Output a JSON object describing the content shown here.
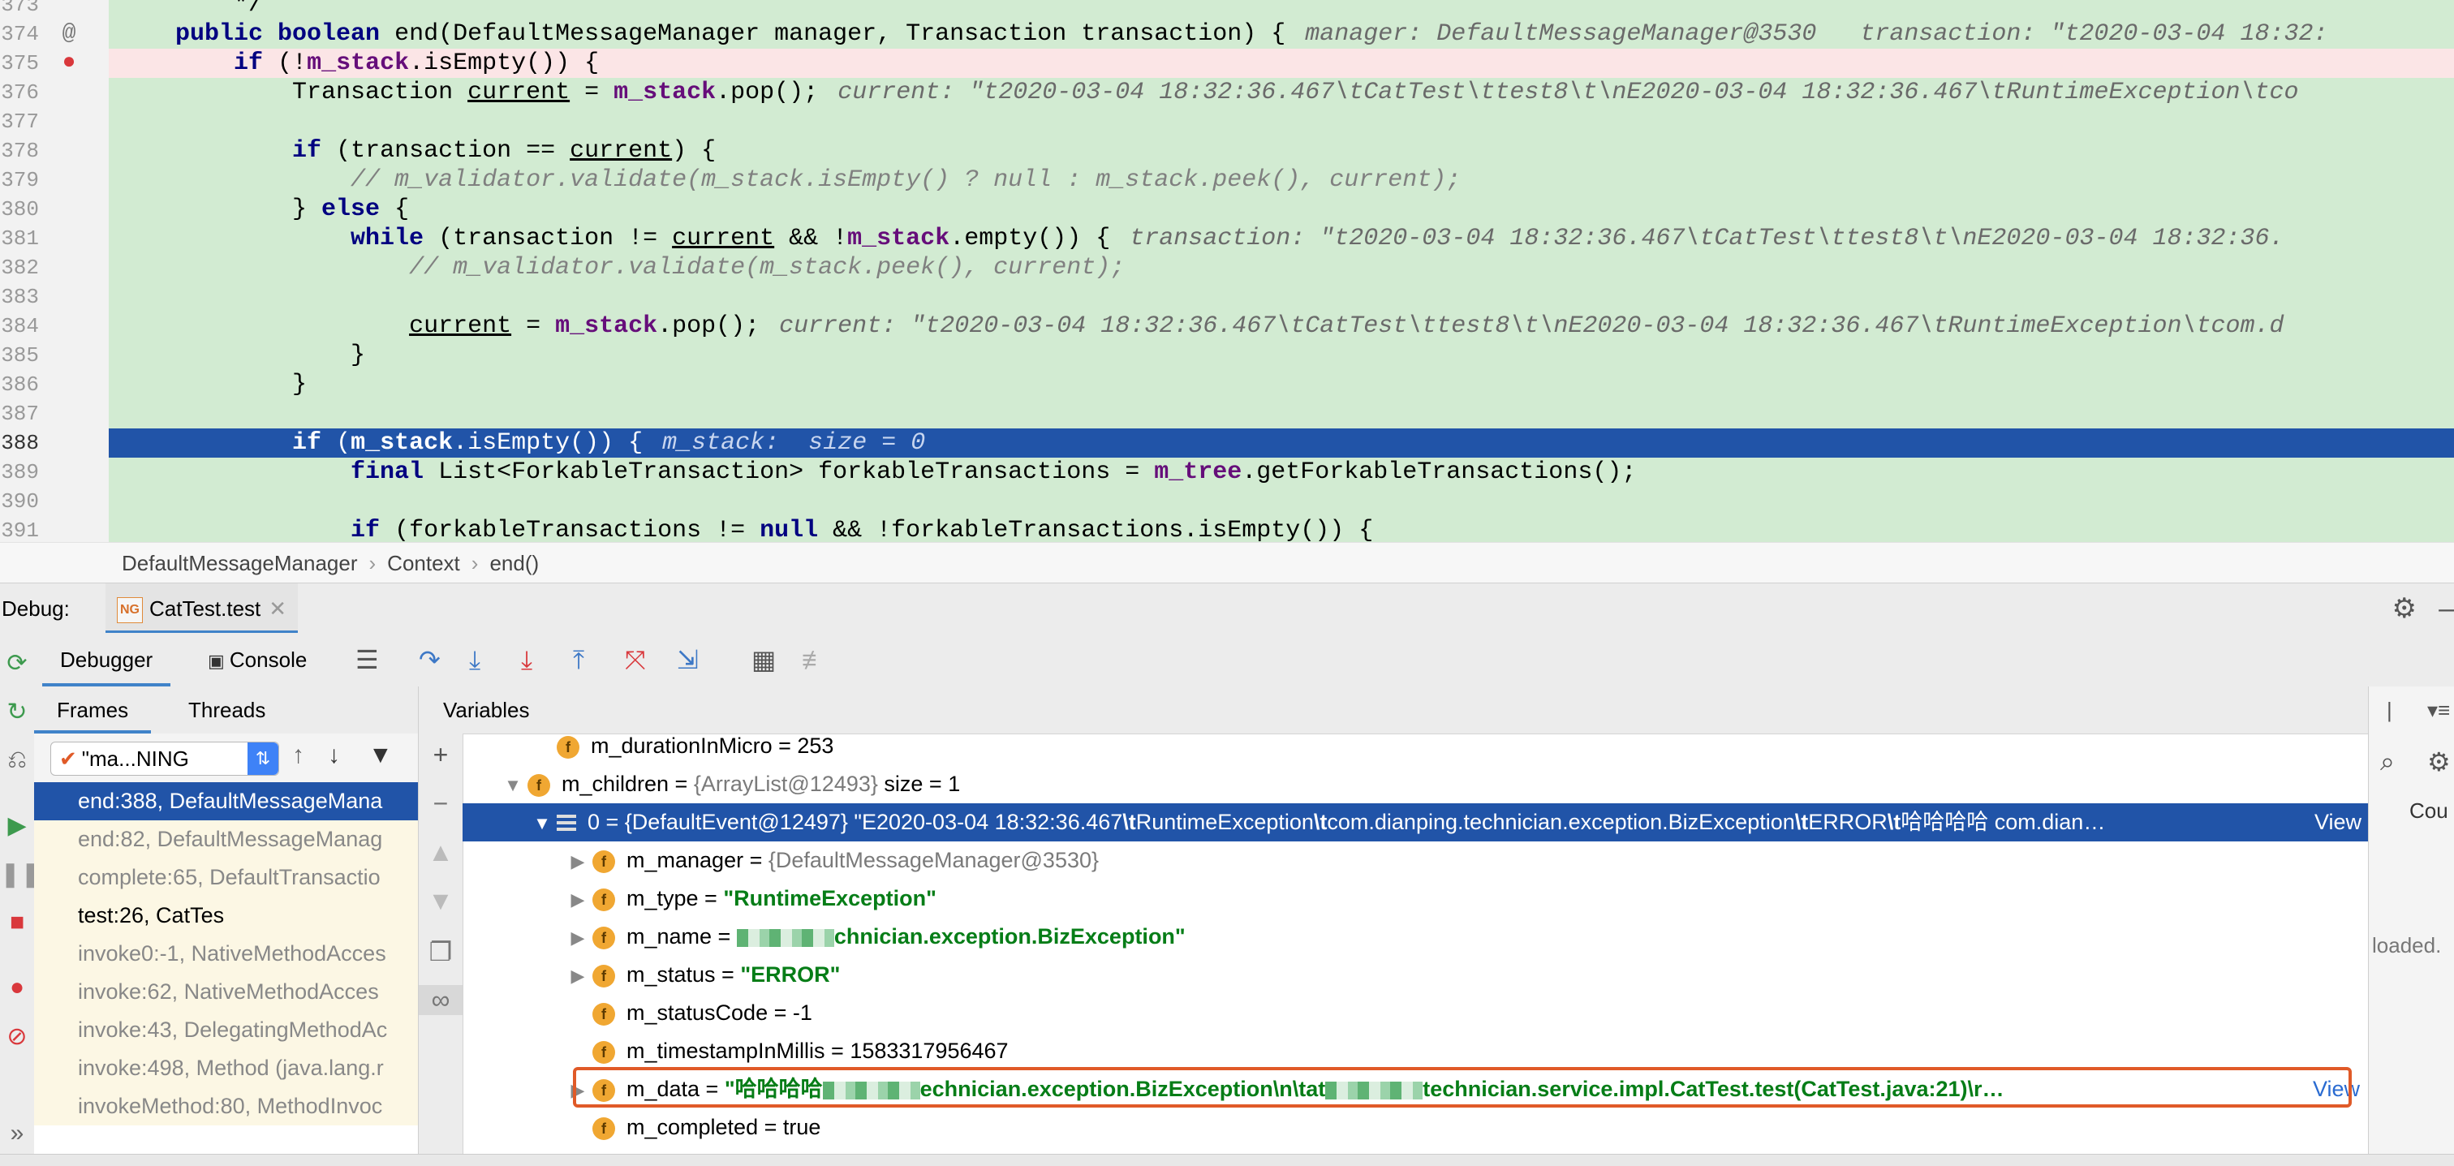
{
  "editor": {
    "lines": [
      {
        "num": "373",
        "marker": "",
        "code_html": "        */",
        "state": ""
      },
      {
        "num": "374",
        "marker": "@",
        "code_html": "    <span class=\"k\">public boolean</span> end(DefaultMessageManager manager, Transaction transaction) {<span class=\"hint\">manager: DefaultMessageManager@3530   transaction: \"t2020-03-04 18:32:</span>",
        "state": ""
      },
      {
        "num": "375",
        "marker": "●",
        "code_html": "        <span class=\"k\">if</span> (!<span class=\"f\">m_stack</span>.isEmpty()) {",
        "state": "err"
      },
      {
        "num": "376",
        "marker": "",
        "code_html": "            Transaction <span class=\"u\">current</span> = <span class=\"f\">m_stack</span>.pop();<span class=\"hint\">current: \"t2020-03-04 18:32:36.467\\tCatTest\\ttest8\\t\\nE2020-03-04 18:32:36.467\\tRuntimeException\\tco</span>",
        "state": ""
      },
      {
        "num": "377",
        "marker": "",
        "code_html": "",
        "state": ""
      },
      {
        "num": "378",
        "marker": "",
        "code_html": "            <span class=\"k\">if</span> (transaction == <span class=\"u\">current</span>) {",
        "state": ""
      },
      {
        "num": "379",
        "marker": "",
        "code_html": "                <span class=\"c\">// m_validator.validate(m_stack.isEmpty() ? null : m_stack.peek(), current);</span>",
        "state": ""
      },
      {
        "num": "380",
        "marker": "",
        "code_html": "            } <span class=\"k\">else</span> {",
        "state": ""
      },
      {
        "num": "381",
        "marker": "",
        "code_html": "                <span class=\"k\">while</span> (transaction != <span class=\"u\">current</span> &amp;&amp; !<span class=\"f\">m_stack</span>.empty()) {<span class=\"hint\">transaction: \"t2020-03-04 18:32:36.467\\tCatTest\\ttest8\\t\\nE2020-03-04 18:32:36.</span>",
        "state": ""
      },
      {
        "num": "382",
        "marker": "",
        "code_html": "                    <span class=\"c\">// m_validator.validate(m_stack.peek(), current);</span>",
        "state": ""
      },
      {
        "num": "383",
        "marker": "",
        "code_html": "",
        "state": ""
      },
      {
        "num": "384",
        "marker": "",
        "code_html": "                    <span class=\"u\">current</span> = <span class=\"f\">m_stack</span>.pop();<span class=\"hint\">current: \"t2020-03-04 18:32:36.467\\tCatTest\\ttest8\\t\\nE2020-03-04 18:32:36.467\\tRuntimeException\\tcom.d</span>",
        "state": ""
      },
      {
        "num": "385",
        "marker": "",
        "code_html": "                }",
        "state": ""
      },
      {
        "num": "386",
        "marker": "",
        "code_html": "            }",
        "state": ""
      },
      {
        "num": "387",
        "marker": "",
        "code_html": "",
        "state": ""
      },
      {
        "num": "388",
        "marker": "",
        "code_html": "            <span class=\"k\">if</span> (<span class=\"f\">m_stack</span>.isEmpty()) {<span class=\"hint\">m_stack:  size = 0</span>",
        "state": "cur"
      },
      {
        "num": "389",
        "marker": "",
        "code_html": "                <span class=\"k\">final</span> List&lt;ForkableTransaction&gt; forkableTransactions = <span class=\"f\">m_tree</span>.getForkableTransactions();",
        "state": ""
      },
      {
        "num": "390",
        "marker": "",
        "code_html": "",
        "state": ""
      },
      {
        "num": "391",
        "marker": "",
        "code_html": "                <span class=\"k\">if</span> (forkableTransactions != <span class=\"k\">null</span> &amp;&amp; !forkableTransactions.isEmpty()) {",
        "state": ""
      }
    ]
  },
  "breadcrumb": {
    "items": [
      "DefaultMessageManager",
      "Context",
      "end()"
    ]
  },
  "debug": {
    "label": "Debug:",
    "session_tab": "CatTest.test"
  },
  "toolbar": {
    "debugger_tab": "Debugger",
    "console_tab": "Console"
  },
  "frames_panel": {
    "tab_frames": "Frames",
    "tab_threads": "Threads",
    "thread_select": "\"ma...NING",
    "frames": [
      {
        "text": "end:388, DefaultMessageMana",
        "state": "sel"
      },
      {
        "text": "end:82, DefaultMessageManag",
        "state": ""
      },
      {
        "text": "complete:65, DefaultTransactio",
        "state": ""
      },
      {
        "text": "test:26, CatTes",
        "state": "bold"
      },
      {
        "text": "invoke0:-1, NativeMethodAcces",
        "state": ""
      },
      {
        "text": "invoke:62, NativeMethodAcces",
        "state": ""
      },
      {
        "text": "invoke:43, DelegatingMethodAc",
        "state": ""
      },
      {
        "text": "invoke:498, Method (java.lang.r",
        "state": ""
      },
      {
        "text": "invokeMethod:80, MethodInvoc",
        "state": ""
      }
    ]
  },
  "variables_panel": {
    "title": "Variables",
    "rows": [
      {
        "indent": 80,
        "arrow": "",
        "icon": "f",
        "html": "m_durationInMicro = 253",
        "state": ""
      },
      {
        "indent": 44,
        "arrow": "▼",
        "icon": "f",
        "html": "m_children = <span class=\"gray\">{ArrayList@12493}</span>  size = 1",
        "state": ""
      },
      {
        "indent": 80,
        "arrow": "▼",
        "icon": "e",
        "html": "0 = {DefaultEvent@12497} \"E2020-03-04 18:32:36.467<b>\\t</b>RuntimeException<b>\\t</b>com.dianping.technician.exception.BizException<b>\\t</b>ERROR<b>\\t</b>哈哈哈哈 com.dian…",
        "state": "sel",
        "link": "View"
      },
      {
        "indent": 124,
        "arrow": "▶",
        "icon": "f",
        "html": "m_manager = <span class=\"gray\">{DefaultMessageManager@3530}</span>",
        "state": ""
      },
      {
        "indent": 124,
        "arrow": "▶",
        "icon": "f",
        "html": "m_type = <span class=\"str\">\"RuntimeException\"</span>",
        "state": ""
      },
      {
        "indent": 124,
        "arrow": "▶",
        "icon": "f",
        "html": "m_name = <span class=\"blur\"></span><span class=\"str\">chnician.exception.BizException\"</span>",
        "state": ""
      },
      {
        "indent": 124,
        "arrow": "▶",
        "icon": "f",
        "html": "m_status = <span class=\"str\">\"ERROR\"</span>",
        "state": ""
      },
      {
        "indent": 124,
        "arrow": "",
        "icon": "f",
        "html": "m_statusCode = -1",
        "state": ""
      },
      {
        "indent": 124,
        "arrow": "",
        "icon": "f",
        "html": "m_timestampInMillis = 1583317956467",
        "state": ""
      },
      {
        "indent": 124,
        "arrow": "▶",
        "icon": "f",
        "html": "m_data = <span class=\"str\">\"哈哈哈哈</span><span class=\"blur\"></span><span class=\"str\">echnician.exception.BizException\\n\\tat</span><span class=\"blur\"></span><span class=\"str\">technician.service.impl.CatTest.test(CatTest.java:21)\\r…</span>",
        "state": "",
        "link": "View"
      },
      {
        "indent": 124,
        "arrow": "",
        "icon": "f",
        "html": "m_completed = true",
        "state": ""
      }
    ]
  },
  "right_panel": {
    "col": "Cou",
    "note": "loaded."
  },
  "colors": {
    "selection": "#2154a8",
    "diff_green": "#d2ebd2",
    "highlight_box": "#e05a28"
  }
}
